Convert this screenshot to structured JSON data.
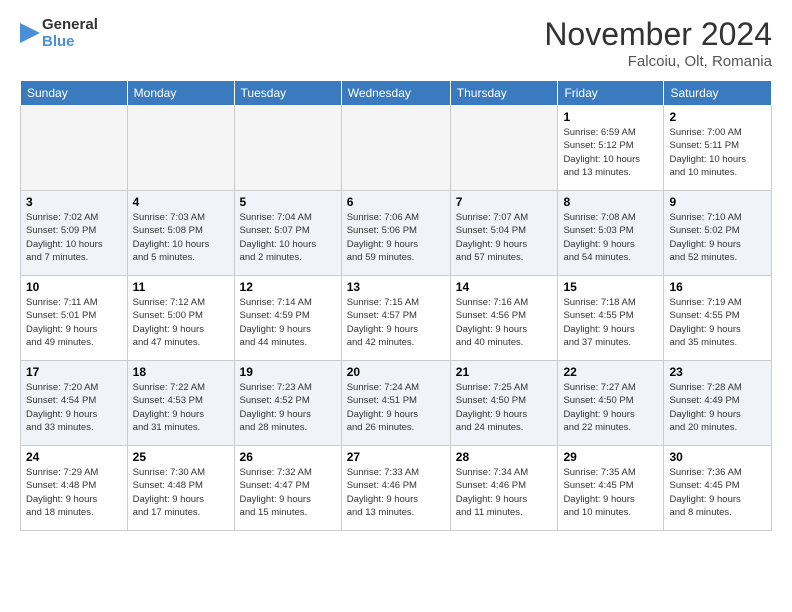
{
  "header": {
    "logo_line1": "General",
    "logo_line2": "Blue",
    "month_title": "November 2024",
    "location": "Falcoiu, Olt, Romania"
  },
  "weekdays": [
    "Sunday",
    "Monday",
    "Tuesday",
    "Wednesday",
    "Thursday",
    "Friday",
    "Saturday"
  ],
  "weeks": [
    [
      {
        "day": "",
        "info": ""
      },
      {
        "day": "",
        "info": ""
      },
      {
        "day": "",
        "info": ""
      },
      {
        "day": "",
        "info": ""
      },
      {
        "day": "",
        "info": ""
      },
      {
        "day": "1",
        "info": "Sunrise: 6:59 AM\nSunset: 5:12 PM\nDaylight: 10 hours\nand 13 minutes."
      },
      {
        "day": "2",
        "info": "Sunrise: 7:00 AM\nSunset: 5:11 PM\nDaylight: 10 hours\nand 10 minutes."
      }
    ],
    [
      {
        "day": "3",
        "info": "Sunrise: 7:02 AM\nSunset: 5:09 PM\nDaylight: 10 hours\nand 7 minutes."
      },
      {
        "day": "4",
        "info": "Sunrise: 7:03 AM\nSunset: 5:08 PM\nDaylight: 10 hours\nand 5 minutes."
      },
      {
        "day": "5",
        "info": "Sunrise: 7:04 AM\nSunset: 5:07 PM\nDaylight: 10 hours\nand 2 minutes."
      },
      {
        "day": "6",
        "info": "Sunrise: 7:06 AM\nSunset: 5:06 PM\nDaylight: 9 hours\nand 59 minutes."
      },
      {
        "day": "7",
        "info": "Sunrise: 7:07 AM\nSunset: 5:04 PM\nDaylight: 9 hours\nand 57 minutes."
      },
      {
        "day": "8",
        "info": "Sunrise: 7:08 AM\nSunset: 5:03 PM\nDaylight: 9 hours\nand 54 minutes."
      },
      {
        "day": "9",
        "info": "Sunrise: 7:10 AM\nSunset: 5:02 PM\nDaylight: 9 hours\nand 52 minutes."
      }
    ],
    [
      {
        "day": "10",
        "info": "Sunrise: 7:11 AM\nSunset: 5:01 PM\nDaylight: 9 hours\nand 49 minutes."
      },
      {
        "day": "11",
        "info": "Sunrise: 7:12 AM\nSunset: 5:00 PM\nDaylight: 9 hours\nand 47 minutes."
      },
      {
        "day": "12",
        "info": "Sunrise: 7:14 AM\nSunset: 4:59 PM\nDaylight: 9 hours\nand 44 minutes."
      },
      {
        "day": "13",
        "info": "Sunrise: 7:15 AM\nSunset: 4:57 PM\nDaylight: 9 hours\nand 42 minutes."
      },
      {
        "day": "14",
        "info": "Sunrise: 7:16 AM\nSunset: 4:56 PM\nDaylight: 9 hours\nand 40 minutes."
      },
      {
        "day": "15",
        "info": "Sunrise: 7:18 AM\nSunset: 4:55 PM\nDaylight: 9 hours\nand 37 minutes."
      },
      {
        "day": "16",
        "info": "Sunrise: 7:19 AM\nSunset: 4:55 PM\nDaylight: 9 hours\nand 35 minutes."
      }
    ],
    [
      {
        "day": "17",
        "info": "Sunrise: 7:20 AM\nSunset: 4:54 PM\nDaylight: 9 hours\nand 33 minutes."
      },
      {
        "day": "18",
        "info": "Sunrise: 7:22 AM\nSunset: 4:53 PM\nDaylight: 9 hours\nand 31 minutes."
      },
      {
        "day": "19",
        "info": "Sunrise: 7:23 AM\nSunset: 4:52 PM\nDaylight: 9 hours\nand 28 minutes."
      },
      {
        "day": "20",
        "info": "Sunrise: 7:24 AM\nSunset: 4:51 PM\nDaylight: 9 hours\nand 26 minutes."
      },
      {
        "day": "21",
        "info": "Sunrise: 7:25 AM\nSunset: 4:50 PM\nDaylight: 9 hours\nand 24 minutes."
      },
      {
        "day": "22",
        "info": "Sunrise: 7:27 AM\nSunset: 4:50 PM\nDaylight: 9 hours\nand 22 minutes."
      },
      {
        "day": "23",
        "info": "Sunrise: 7:28 AM\nSunset: 4:49 PM\nDaylight: 9 hours\nand 20 minutes."
      }
    ],
    [
      {
        "day": "24",
        "info": "Sunrise: 7:29 AM\nSunset: 4:48 PM\nDaylight: 9 hours\nand 18 minutes."
      },
      {
        "day": "25",
        "info": "Sunrise: 7:30 AM\nSunset: 4:48 PM\nDaylight: 9 hours\nand 17 minutes."
      },
      {
        "day": "26",
        "info": "Sunrise: 7:32 AM\nSunset: 4:47 PM\nDaylight: 9 hours\nand 15 minutes."
      },
      {
        "day": "27",
        "info": "Sunrise: 7:33 AM\nSunset: 4:46 PM\nDaylight: 9 hours\nand 13 minutes."
      },
      {
        "day": "28",
        "info": "Sunrise: 7:34 AM\nSunset: 4:46 PM\nDaylight: 9 hours\nand 11 minutes."
      },
      {
        "day": "29",
        "info": "Sunrise: 7:35 AM\nSunset: 4:45 PM\nDaylight: 9 hours\nand 10 minutes."
      },
      {
        "day": "30",
        "info": "Sunrise: 7:36 AM\nSunset: 4:45 PM\nDaylight: 9 hours\nand 8 minutes."
      }
    ]
  ]
}
